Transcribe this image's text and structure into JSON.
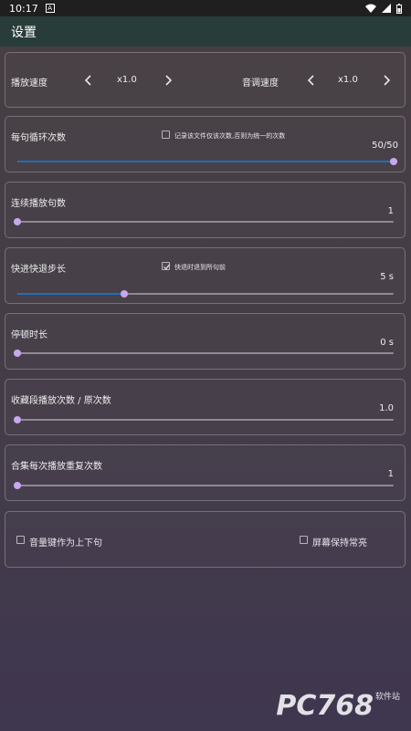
{
  "status_bar": {
    "time": "10:17"
  },
  "app_bar": {
    "title": "设置"
  },
  "speed_card": {
    "playback_label": "播放速度",
    "playback_value": "x1.0",
    "pitch_label": "音调速度",
    "pitch_value": "x1.0"
  },
  "loop_card": {
    "label": "每句循环次数",
    "checkbox_label": "记录该文件仅该次数,否则为统一的次数",
    "checkbox_checked": false,
    "value": "50/50",
    "fraction": 1.0
  },
  "consecutive_card": {
    "label": "连续播放句数",
    "value": "1",
    "fraction": 0.0
  },
  "seek_card": {
    "label": "快进快退步长",
    "checkbox_label": "快退时退到所句前",
    "checkbox_checked": true,
    "value": "5 s",
    "fraction": 0.285
  },
  "pause_card": {
    "label": "停顿时长",
    "value": "0 s",
    "fraction": 0.0
  },
  "favorite_card": {
    "label": "收藏段播放次数 / 原次数",
    "value": "1.0",
    "fraction": 0.0
  },
  "collection_card": {
    "label": "合集每次播放重复次数",
    "value": "1",
    "fraction": 0.0
  },
  "options_card": {
    "volume_key_label": "音量键作为上下句",
    "volume_key_checked": false,
    "screen_on_label": "屏幕保持常亮",
    "screen_on_checked": false
  },
  "watermark": {
    "text": "PC768",
    "sub": "软件站"
  }
}
